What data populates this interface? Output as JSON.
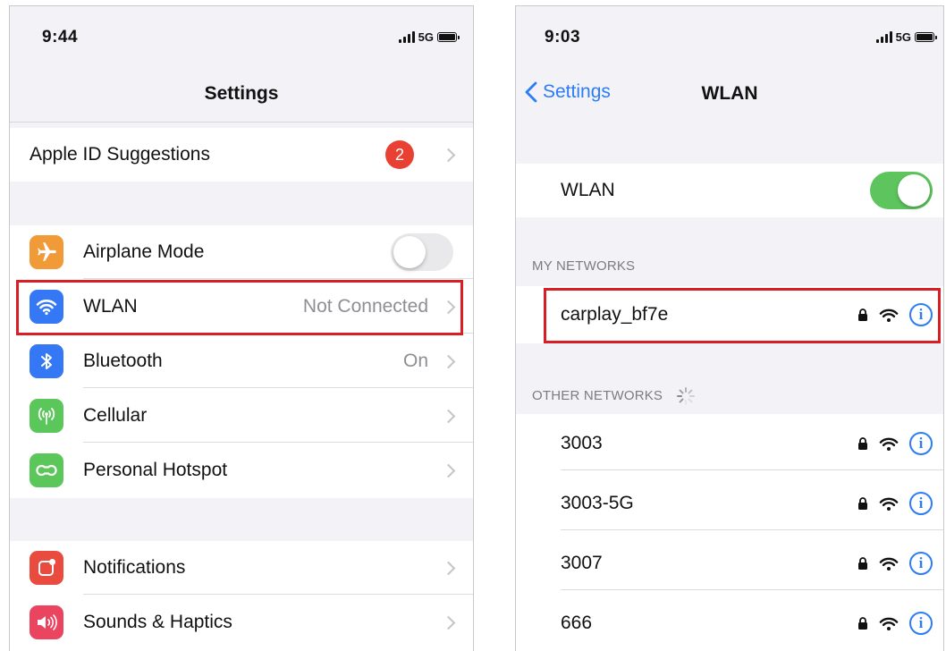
{
  "left_screen": {
    "status": {
      "time": "9:44",
      "network": "5G"
    },
    "title": "Settings",
    "apple_id": {
      "label": "Apple ID Suggestions",
      "badge": "2"
    },
    "connectivity": [
      {
        "label": "Airplane Mode",
        "icon": "airplane-icon",
        "icon_color": "#f19a38",
        "toggle": "off"
      },
      {
        "label": "WLAN",
        "value": "Not Connected",
        "icon": "wifi-icon",
        "icon_color": "#3478f6",
        "highlighted": true
      },
      {
        "label": "Bluetooth",
        "value": "On",
        "icon": "bluetooth-icon",
        "icon_color": "#3478f6"
      },
      {
        "label": "Cellular",
        "icon": "cellular-antenna-icon",
        "icon_color": "#5bc65a"
      },
      {
        "label": "Personal Hotspot",
        "icon": "hotspot-link-icon",
        "icon_color": "#5bc65a"
      }
    ],
    "notifications_group": [
      {
        "label": "Notifications",
        "icon": "notifications-icon",
        "icon_color": "#ea4b3f"
      },
      {
        "label": "Sounds & Haptics",
        "icon": "speaker-icon",
        "icon_color": "#ea4461"
      }
    ]
  },
  "right_screen": {
    "status": {
      "time": "9:03",
      "network": "5G"
    },
    "back_label": "Settings",
    "title": "WLAN",
    "wlan_toggle": {
      "label": "WLAN",
      "state": "on"
    },
    "my_networks_header": "MY NETWORKS",
    "my_networks": [
      {
        "name": "carplay_bf7e",
        "highlighted": true
      }
    ],
    "other_networks_header": "OTHER NETWORKS",
    "other_networks": [
      {
        "name": "3003"
      },
      {
        "name": "3003-5G"
      },
      {
        "name": "3007"
      },
      {
        "name": "666"
      }
    ]
  },
  "colors": {
    "accent_blue": "#2b7cf6",
    "toggle_green": "#5ec55e",
    "highlight_red": "#d91f26",
    "badge_red": "#e84133"
  }
}
